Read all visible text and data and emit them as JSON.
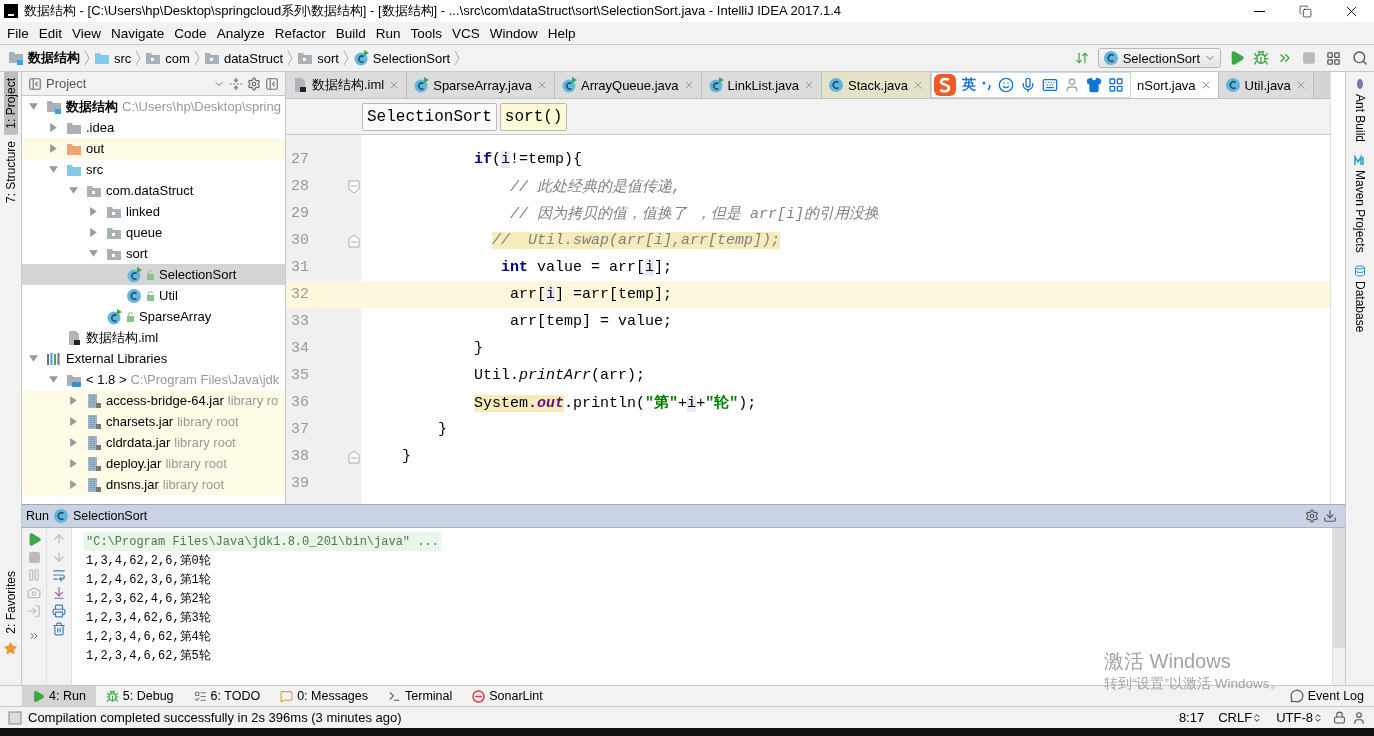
{
  "window": {
    "title": "数据结构 - [C:\\Users\\hp\\Desktop\\springcloud系列\\数据结构] - [数据结构] - ...\\src\\com\\dataStruct\\sort\\SelectionSort.java - IntelliJ IDEA 2017.1.4"
  },
  "menu": [
    "File",
    "Edit",
    "View",
    "Navigate",
    "Code",
    "Analyze",
    "Refactor",
    "Build",
    "Run",
    "Tools",
    "VCS",
    "Window",
    "Help"
  ],
  "breadcrumbs": [
    {
      "label": "数据结构",
      "kind": "module"
    },
    {
      "label": "src",
      "kind": "source-folder"
    },
    {
      "label": "com",
      "kind": "package"
    },
    {
      "label": "dataStruct",
      "kind": "package"
    },
    {
      "label": "sort",
      "kind": "package"
    },
    {
      "label": "SelectionSort",
      "kind": "runnable-class"
    }
  ],
  "run_config": {
    "label": "SelectionSort"
  },
  "left_stripe": [
    {
      "label": "1: Project",
      "selected": true
    },
    {
      "label": "7: Structure",
      "selected": false
    }
  ],
  "left_stripe_bottom": [
    {
      "label": "2: Favorites",
      "selected": false
    }
  ],
  "right_stripe": [
    {
      "label": "Ant Build",
      "kind": "ant"
    },
    {
      "label": "Maven Projects",
      "kind": "maven"
    },
    {
      "label": "Database",
      "kind": "database"
    }
  ],
  "project": {
    "title": "Project",
    "tree": [
      {
        "label": "数据结构",
        "hint": "C:\\Users\\hp\\Desktop\\spring",
        "kind": "module",
        "expanded": true,
        "selected": false,
        "tinted": false,
        "children": [
          {
            "label": ".idea",
            "kind": "folder",
            "expanded": false,
            "selected": false,
            "tinted": false
          },
          {
            "label": "out",
            "kind": "excluded-folder",
            "expanded": false,
            "selected": false,
            "tinted": true
          },
          {
            "label": "src",
            "kind": "source-folder",
            "expanded": true,
            "selected": false,
            "tinted": false,
            "children": [
              {
                "label": "com.dataStruct",
                "kind": "package",
                "expanded": true,
                "selected": false,
                "tinted": false,
                "children": [
                  {
                    "label": "linked",
                    "kind": "package",
                    "expanded": false,
                    "selected": false,
                    "tinted": false
                  },
                  {
                    "label": "queue",
                    "kind": "package",
                    "expanded": false,
                    "selected": false,
                    "tinted": false
                  },
                  {
                    "label": "sort",
                    "kind": "package",
                    "expanded": true,
                    "selected": false,
                    "tinted": false,
                    "children": [
                      {
                        "label": "SelectionSort",
                        "kind": "runnable-class",
                        "selected": true,
                        "tinted": false
                      },
                      {
                        "label": "Util",
                        "kind": "class",
                        "selected": false,
                        "tinted": false
                      }
                    ]
                  },
                  {
                    "label": "SparseArray",
                    "kind": "runnable-class",
                    "selected": false,
                    "tinted": false
                  }
                ]
              }
            ]
          },
          {
            "label": "数据结构.iml",
            "kind": "file",
            "selected": false,
            "tinted": false
          }
        ]
      },
      {
        "label": "External Libraries",
        "kind": "libraries",
        "expanded": true,
        "selected": false,
        "tinted": false,
        "children": [
          {
            "label": "< 1.8 >",
            "hint": "C:\\Program Files\\Java\\jdk",
            "kind": "jdk",
            "expanded": true,
            "selected": false,
            "tinted": false,
            "children": [
              {
                "label": "access-bridge-64.jar",
                "hint": "library ro",
                "kind": "jar",
                "expanded": false,
                "selected": false,
                "tinted": true
              },
              {
                "label": "charsets.jar",
                "hint": "library root",
                "kind": "jar",
                "expanded": false,
                "selected": false,
                "tinted": true
              },
              {
                "label": "cldrdata.jar",
                "hint": "library root",
                "kind": "jar",
                "expanded": false,
                "selected": false,
                "tinted": true
              },
              {
                "label": "deploy.jar",
                "hint": "library root",
                "kind": "jar",
                "expanded": false,
                "selected": false,
                "tinted": true
              },
              {
                "label": "dnsns.jar",
                "hint": "library root",
                "kind": "jar",
                "expanded": false,
                "selected": false,
                "tinted": true
              }
            ]
          }
        ]
      }
    ]
  },
  "editor": {
    "tabs": [
      {
        "label": "数据结构.iml",
        "kind": "file",
        "selected": false,
        "tinted": false
      },
      {
        "label": "SparseArray.java",
        "kind": "runnable-class",
        "selected": false,
        "tinted": false
      },
      {
        "label": "ArrayQueue.java",
        "kind": "runnable-class",
        "selected": false,
        "tinted": false
      },
      {
        "label": "LinkList.java",
        "kind": "runnable-class",
        "selected": false,
        "tinted": false
      },
      {
        "label": "Stack.java",
        "kind": "class",
        "selected": false,
        "tinted": true
      },
      {
        "label": "nSort.java",
        "kind": "hidden",
        "selected": true,
        "tinted": false
      },
      {
        "label": "Util.java",
        "kind": "class",
        "selected": false,
        "tinted": false
      }
    ],
    "ime_bar": {
      "label": "英"
    },
    "crumbs": [
      {
        "label": "SelectionSort",
        "selected": false
      },
      {
        "label": "sort()",
        "selected": true
      }
    ],
    "lines": [
      {
        "number": "27",
        "current": false,
        "tokens": [
          {
            "kind": "keyword",
            "text": "            if"
          },
          {
            "kind": "plain",
            "text": "("
          },
          {
            "kind": "usage",
            "text": "i"
          },
          {
            "kind": "plain",
            "text": "!=temp){"
          }
        ]
      },
      {
        "number": "28",
        "current": false,
        "fold": {
          "kind": "open"
        },
        "tokens": [
          {
            "kind": "comment",
            "text": "                // 此处经典的是值传递,"
          }
        ]
      },
      {
        "number": "29",
        "current": false,
        "tokens": [
          {
            "kind": "comment",
            "text": "                // 因为拷贝的值，值换了 ，但是 arr[i]的引用没换"
          }
        ]
      },
      {
        "number": "30",
        "current": false,
        "fold": {
          "kind": "close"
        },
        "tokens": [
          {
            "kind": "comment",
            "text": "              //  Util.swap(arr[i],arr[temp]);",
            "marked": true
          }
        ]
      },
      {
        "number": "31",
        "current": false,
        "tokens": [
          {
            "kind": "keyword",
            "text": "               int"
          },
          {
            "kind": "plain",
            "text": " value = arr["
          },
          {
            "kind": "usage",
            "text": "i"
          },
          {
            "kind": "plain",
            "text": "];"
          }
        ]
      },
      {
        "number": "32",
        "current": true,
        "tokens": [
          {
            "kind": "plain",
            "text": "                arr["
          },
          {
            "kind": "usage",
            "text": "i"
          },
          {
            "kind": "plain",
            "text": "] =arr[temp];"
          }
        ]
      },
      {
        "number": "33",
        "current": false,
        "tokens": [
          {
            "kind": "plain",
            "text": "                arr[temp] = value;"
          }
        ]
      },
      {
        "number": "34",
        "current": false,
        "tokens": [
          {
            "kind": "plain",
            "text": "            }"
          }
        ]
      },
      {
        "number": "35",
        "current": false,
        "tokens": [
          {
            "kind": "plain",
            "text": "            Util."
          },
          {
            "kind": "method",
            "text": "printArr"
          },
          {
            "kind": "plain",
            "text": "(arr);"
          }
        ]
      },
      {
        "number": "36",
        "current": false,
        "tokens": [
          {
            "kind": "plain",
            "text": "            System.",
            "marked": true
          },
          {
            "kind": "field",
            "text": "out",
            "marked": true
          },
          {
            "kind": "plain",
            "text": ".println("
          },
          {
            "kind": "string",
            "text": "\"第\""
          },
          {
            "kind": "plain",
            "text": "+"
          },
          {
            "kind": "usage",
            "text": "i"
          },
          {
            "kind": "plain",
            "text": "+"
          },
          {
            "kind": "string",
            "text": "\"轮\""
          },
          {
            "kind": "plain",
            "text": ");"
          }
        ]
      },
      {
        "number": "37",
        "current": false,
        "tokens": [
          {
            "kind": "plain",
            "text": "        }"
          }
        ]
      },
      {
        "number": "38",
        "current": false,
        "fold": {
          "kind": "close"
        },
        "tokens": [
          {
            "kind": "plain",
            "text": "    }"
          }
        ]
      },
      {
        "number": "39",
        "current": false
      }
    ]
  },
  "run_panel": {
    "label": "Run",
    "config": "SelectionSort",
    "console": [
      {
        "kind": "command",
        "text": "\"C:\\Program Files\\Java\\jdk1.8.0_201\\bin\\java\" ..."
      },
      {
        "kind": "output",
        "text": "1,3,4,62,2,6,第0轮"
      },
      {
        "kind": "output",
        "text": "1,2,4,62,3,6,第1轮"
      },
      {
        "kind": "output",
        "text": "1,2,3,62,4,6,第2轮"
      },
      {
        "kind": "output",
        "text": "1,2,3,4,62,6,第3轮"
      },
      {
        "kind": "output",
        "text": "1,2,3,4,6,62,第4轮"
      },
      {
        "kind": "output",
        "text": "1,2,3,4,6,62,第5轮"
      }
    ]
  },
  "tool_windows": [
    {
      "label": "4: Run",
      "kind": "run",
      "selected": true
    },
    {
      "label": "5: Debug",
      "kind": "debug",
      "selected": false
    },
    {
      "label": "6: TODO",
      "kind": "todo",
      "selected": false
    },
    {
      "label": "0: Messages",
      "kind": "messages",
      "selected": false
    },
    {
      "label": "Terminal",
      "kind": "terminal",
      "selected": false
    },
    {
      "label": "SonarLint",
      "kind": "sonar",
      "selected": false
    }
  ],
  "event_log": "Event Log",
  "status_bar": {
    "message": "Compilation completed successfully in 2s 396ms (3 minutes ago)",
    "position": "8:17",
    "line_separator": "CRLF",
    "encoding": "UTF-8"
  },
  "activation_notice": {
    "title": "激活 Windows",
    "subtitle": "转到“设置”以激活 Windows。"
  }
}
